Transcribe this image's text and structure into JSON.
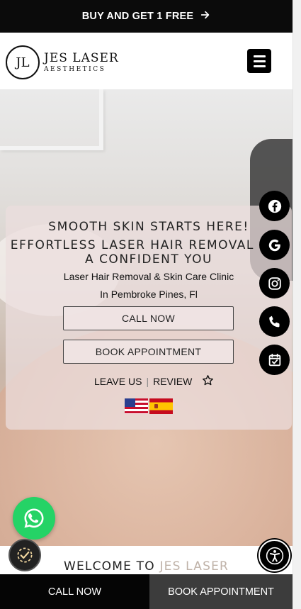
{
  "promo_bar": {
    "text": "BUY AND GET 1 FREE",
    "arrow_icon": "arrow-right-icon"
  },
  "header": {
    "logo": {
      "mark": "JL",
      "title": "JES LASER",
      "subtitle": "AESTHETICS"
    },
    "menu_icon": "hamburger-menu-icon"
  },
  "hero": {
    "headline_1": "SMOOTH SKIN STARTS HERE!",
    "headline_2": "EFFORTLESS LASER HAIR REMOVAL FOR A CONFIDENT YOU",
    "clinic_line": "Laser Hair Removal & Skin Care Clinic",
    "location_line": "In Pembroke Pines, Fl",
    "call_button": "CALL NOW",
    "book_button": "BOOK APPOINTMENT",
    "review": {
      "left": "LEAVE US",
      "right": "REVIEW"
    },
    "flags": [
      "us-flag",
      "spain-flag"
    ]
  },
  "social_buttons": [
    {
      "name": "facebook-icon"
    },
    {
      "name": "google-icon"
    },
    {
      "name": "instagram-icon"
    },
    {
      "name": "phone-icon"
    },
    {
      "name": "calendar-check-icon"
    }
  ],
  "welcome": {
    "prefix": "WELCOME TO",
    "accent": "JES LASER"
  },
  "bottom_bar": {
    "call": "CALL NOW",
    "book": "BOOK APPOINTMENT"
  },
  "colors": {
    "promo_bg": "#0b0b0b",
    "whatsapp": "#25d366",
    "bottom_left": "#050505",
    "bottom_right": "#3c3c3c"
  }
}
